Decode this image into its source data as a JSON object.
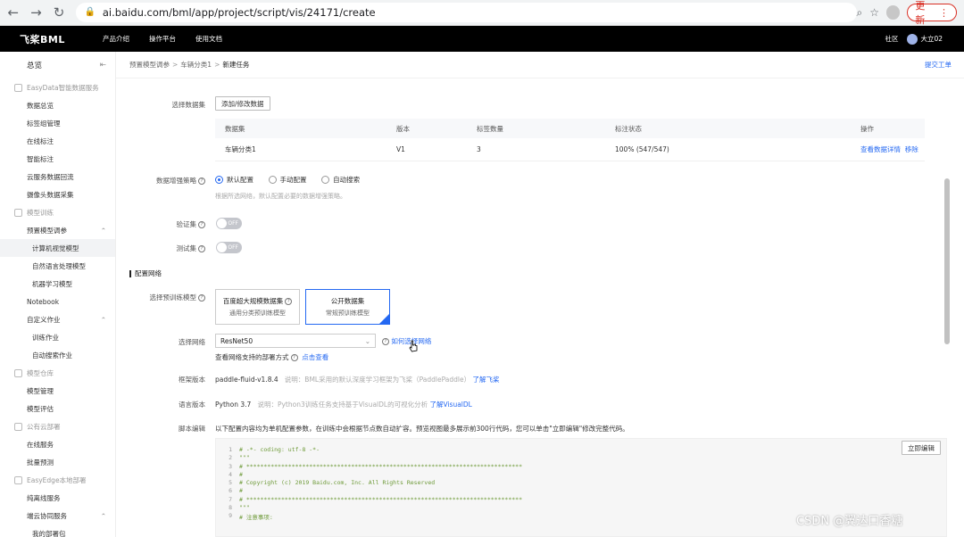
{
  "browser": {
    "url": "ai.baidu.com/bml/app/project/script/vis/24171/create",
    "update_label": "更新"
  },
  "topbar": {
    "logo": "飞桨BML",
    "nav": [
      "产品介绍",
      "操作平台",
      "使用文档"
    ],
    "community": "社区",
    "username": "大立02"
  },
  "sidebar": {
    "overview": "总览",
    "g1": "EasyData智能数据服务",
    "g1_items": [
      "数据总览",
      "标签组管理",
      "在线标注",
      "智能标注",
      "云服务数据回流",
      "摄像头数据采集"
    ],
    "g2": "模型训练",
    "preset": "预置模型调参",
    "preset_items": [
      "计算机视觉模型",
      "自然语言处理模型",
      "机器学习模型"
    ],
    "notebook": "Notebook",
    "custom": "自定义作业",
    "custom_items": [
      "训练作业",
      "自动搜索作业"
    ],
    "g3": "模型仓库",
    "g3_items": [
      "模型管理",
      "模型评估"
    ],
    "g4": "公有云部署",
    "g4_items": [
      "在线服务",
      "批量预测"
    ],
    "g5": "EasyEdge本地部署",
    "g5_items": [
      "纯离线服务",
      "端云协同服务",
      "我的部署包"
    ]
  },
  "breadcrumb": {
    "items": [
      "预置模型调参",
      "车辆分类1",
      "新建任务"
    ],
    "ticket": "提交工单"
  },
  "dataset": {
    "label": "选择数据集",
    "button": "添加/修改数据",
    "headers": [
      "数据集",
      "版本",
      "标签数量",
      "标注状态",
      "操作"
    ],
    "row": {
      "name": "车辆分类1",
      "version": "V1",
      "labels": "3",
      "status": "100% (547/547)",
      "detail": "查看数据详情",
      "remove": "移除"
    }
  },
  "augment": {
    "label": "数据增强策略",
    "options": [
      "默认配置",
      "手动配置",
      "自动搜索"
    ],
    "hint": "根据所选网络，默认配置必要的数据增强策略。"
  },
  "validation": {
    "label": "验证集",
    "state": "OFF"
  },
  "test": {
    "label": "测试集",
    "state": "OFF"
  },
  "network_section": "配置网络",
  "pretrain": {
    "label": "选择预训练模型",
    "card1_title": "百度超大规模数据集",
    "card1_sub": "通用分类预训练模型",
    "card2_title": "公开数据集",
    "card2_sub": "常规预训练模型"
  },
  "network": {
    "label": "选择网络",
    "value": "ResNet50",
    "help": "如何选择网络",
    "deploy_text": "查看网络支持的部署方式",
    "deploy_link": "点击查看"
  },
  "framework": {
    "label": "框架版本",
    "value": "paddle-fluid-v1.8.4",
    "note": "说明：BML采用的默认深度学习框架为飞桨（PaddlePaddle）",
    "link": "了解飞桨"
  },
  "language": {
    "label": "语言版本",
    "value": "Python 3.7",
    "note": "说明：Python3训练任务支持基于VisualDL的可视化分析",
    "link": "了解VisualDL"
  },
  "script": {
    "label": "脚本编辑",
    "desc": "以下配置内容均为单机配置参数，在训练中会根据节点数自动扩容。预览视图最多展示前300行代码，您可以单击\"立即编辑\"修改完整代码。",
    "edit_button": "立即编辑",
    "lines": [
      "# -*- coding: utf-8 -*-",
      "\"\"\"",
      "# *******************************************************************************",
      "#",
      "# Copyright (c) 2019 Baidu.com, Inc. All Rights Reserved",
      "#",
      "# *******************************************************************************",
      "\"\"\"",
      "# 注意事项:"
    ]
  },
  "watermark": "CSDN @翼达口香糖"
}
